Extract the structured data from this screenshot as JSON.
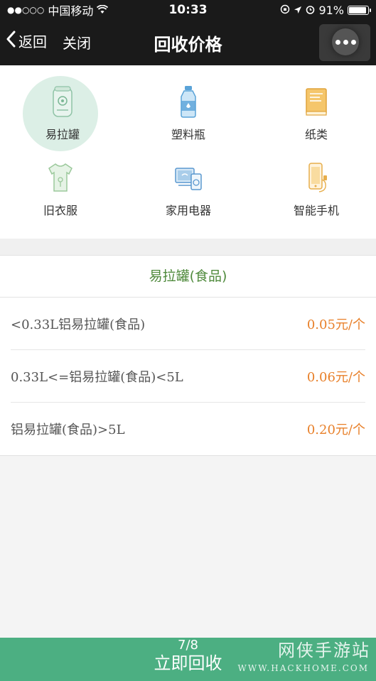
{
  "status_bar": {
    "signal": "●●○○○",
    "carrier": "中国移动",
    "time": "10:33",
    "battery": "91%"
  },
  "nav": {
    "back_label": "返回",
    "close_label": "关闭",
    "title": "回收价格"
  },
  "categories": [
    {
      "label": "易拉罐",
      "icon": "can-icon",
      "active": true
    },
    {
      "label": "塑料瓶",
      "icon": "bottle-icon",
      "active": false
    },
    {
      "label": "纸类",
      "icon": "book-icon",
      "active": false
    },
    {
      "label": "旧衣服",
      "icon": "shirt-icon",
      "active": false
    },
    {
      "label": "家用电器",
      "icon": "appliance-icon",
      "active": false
    },
    {
      "label": "智能手机",
      "icon": "phone-icon",
      "active": false
    }
  ],
  "price_section": {
    "title": "易拉罐(食品)",
    "rows": [
      {
        "name": "<0.33L铝易拉罐(食品)",
        "price": "0.05元/个"
      },
      {
        "name": "0.33L<=铝易拉罐(食品)<5L",
        "price": "0.06元/个"
      },
      {
        "name": "铝易拉罐(食品)>5L",
        "price": "0.20元/个"
      }
    ]
  },
  "bottom": {
    "page_indicator": "7/8",
    "button_label": "立即回收"
  },
  "watermark": {
    "main": "网侠手游站",
    "sub": "WWW.HACKHOME.COM"
  },
  "colors": {
    "accent_green": "#4caf82",
    "title_green": "#4f8a3c",
    "price_orange": "#e8802a",
    "active_bg": "#dcefe6"
  }
}
